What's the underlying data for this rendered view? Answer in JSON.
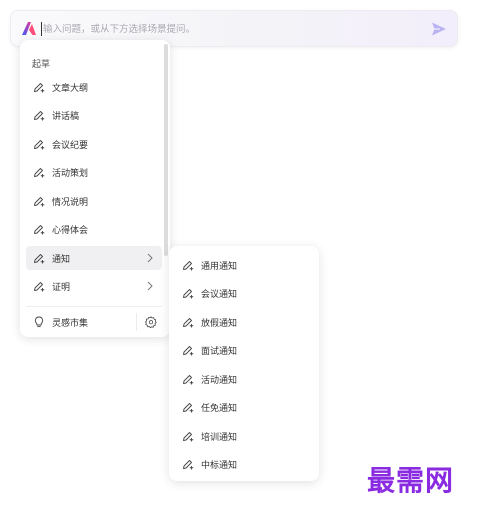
{
  "search": {
    "placeholder": "输入问题，或从下方选择场景提问。"
  },
  "menu": {
    "section_title": "起草",
    "items": [
      {
        "label": "文章大纲"
      },
      {
        "label": "讲话稿"
      },
      {
        "label": "会议纪要"
      },
      {
        "label": "活动策划"
      },
      {
        "label": "情况说明"
      },
      {
        "label": "心得体会"
      },
      {
        "label": "通知",
        "active": true,
        "has_submenu": true
      },
      {
        "label": "证明",
        "has_submenu": true
      }
    ],
    "footer": {
      "label": "灵感市集"
    }
  },
  "submenu": {
    "items": [
      {
        "label": "通用通知"
      },
      {
        "label": "会议通知"
      },
      {
        "label": "放假通知"
      },
      {
        "label": "面试通知"
      },
      {
        "label": "活动通知"
      },
      {
        "label": "任免通知"
      },
      {
        "label": "培训通知"
      },
      {
        "label": "中标通知"
      }
    ]
  },
  "watermark": {
    "text": "最需网",
    "color": "#8a2be2"
  },
  "colors": {
    "accent": "#6b4bf5",
    "send": "#b9b3f2"
  },
  "icons": {
    "logo": "app-logo-icon",
    "send": "send-icon",
    "item": "pen-sparkle-icon",
    "chevron": "chevron-right-icon",
    "footer": "lightbulb-icon",
    "settings": "gear-icon"
  }
}
